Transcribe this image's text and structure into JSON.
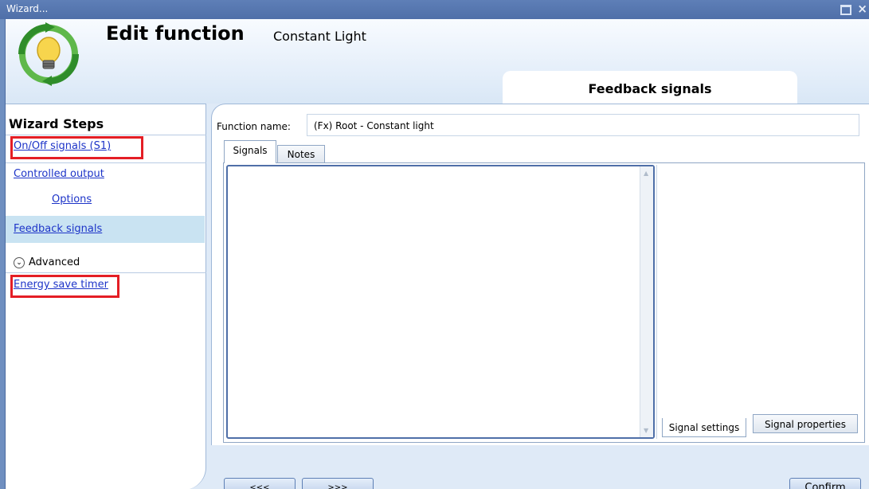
{
  "window": {
    "title": "Wizard..."
  },
  "header": {
    "title": "Edit function",
    "function_type": "Constant Light",
    "current_step": "Feedback signals",
    "logo_icon": "lightbulb-cycle-icon"
  },
  "sidebar": {
    "title": "Wizard Steps",
    "items": [
      {
        "label": "On/Off signals (S1)",
        "highlighted": true
      },
      {
        "label": "Controlled output"
      },
      {
        "label": "Options",
        "indent": true
      },
      {
        "label": "Feedback signals",
        "selected": true
      },
      {
        "label": "Advanced",
        "type": "expander"
      },
      {
        "label": "Energy save timer",
        "highlighted": true
      }
    ]
  },
  "main": {
    "function_name_label": "Function name:",
    "function_name_value": "(Fx) Root - Constant light",
    "tabs": [
      {
        "label": "Signals",
        "active": true
      },
      {
        "label": "Notes"
      }
    ],
    "sub_tabs": [
      {
        "label": "Signal settings",
        "active": true
      },
      {
        "label": "Signal properties"
      }
    ]
  },
  "footer": {
    "prev_label": "<<<",
    "next_label": ">>>",
    "confirm_label": "Confirm"
  },
  "colors": {
    "link": "#1d34c8",
    "highlight_box": "#e41e25",
    "selected_step_bg": "#c9e3f2",
    "titlebar": "#5e7fb7"
  }
}
